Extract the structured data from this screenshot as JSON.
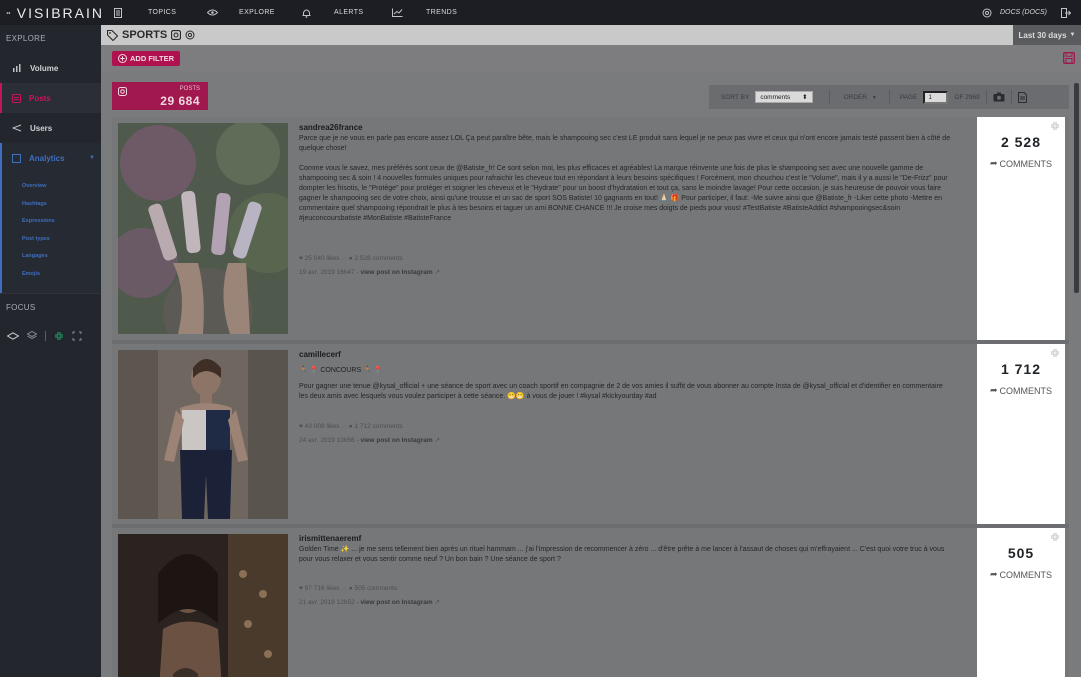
{
  "brand": {
    "name": "VISIBRAIN"
  },
  "nav": [
    {
      "label": "TOPICS",
      "icon": "document-icon"
    },
    {
      "label": "EXPLORE",
      "icon": "eye-icon"
    },
    {
      "label": "ALERTS",
      "icon": "bell-icon"
    },
    {
      "label": "TRENDS",
      "icon": "trend-chart-icon"
    }
  ],
  "topright": {
    "docs": "DOCS (DOCS)"
  },
  "sidebar": {
    "explore_head": "EXPLORE",
    "items": [
      {
        "label": "Volume"
      },
      {
        "label": "Posts"
      },
      {
        "label": "Users"
      },
      {
        "label": "Analytics"
      }
    ],
    "analytics_sub": [
      "Overview",
      "Hashtags",
      "Expressions",
      "Post types",
      "Langages",
      "Emojis"
    ],
    "focus_head": "FOCUS"
  },
  "titlebar": {
    "title": "SPORTS",
    "period": "Last 30 days"
  },
  "filters": {
    "add_label": "ADD FILTER"
  },
  "posts_box": {
    "label": "POSTS",
    "value": "29 684"
  },
  "sortbar": {
    "sort_label": "SORT BY",
    "sort_value": "comments",
    "order_label": "ORDER",
    "page_label": "PAGE",
    "page_value": "1",
    "of_label": "OF 2969"
  },
  "accent": "#c2185b",
  "posts": [
    {
      "user": "sandrea26france",
      "tags": "",
      "text1": "Parce que je ne vous en parle pas encore assez LOL Ça peut paraître bête, mais le shampooing sec c'est LE produit sans lequel je ne peux pas vivre et ceux qui n'ont encore jamais testé passent bien à côté de quelque chose!",
      "text2": "Comme vous le savez, mes préférés sont ceux de @Batiste_fr! Ce sont selon moi, les plus efficaces et agréables! La marque réinvente une fois de plus le shampooing sec avec une nouvelle gamme de shampooing sec & soin ! 4 nouvelles formules uniques pour rafraichir les cheveux tout en répondant à leurs besoins spécifiques ! Forcément, mon chouchou c'est le \"Volume\", mais il y a aussi le \"De-Frizz\" pour dompter les frisotis, le \"Protège\" pour protéger et soigner les cheveux et le \"Hydrate\" pour un boost d'hydratation et tout ça, sans le moindre lavage! Pour cette occasion, je suis heureuse de pouvoir vous faire gagner le shampooing sec de votre choix, ainsi qu'une trousse et un sac de sport SOS Batiste! 10 gagnants en tout! 🙏🏻 🎁 Pour participer, il faut: -Me suivre ainsi que @Batiste_fr -Liker cette photo -Mettre en commentaire quel shampooing répondrait le plus à tes besoins et taguer un ami BONNE CHANCE !!! Je croise mes doigts de pieds pour vous! #TestBatiste #BatisteAddict #shampooingsec&soin #jeuconcoursbatiste #MonBatiste #BatisteFrance",
      "likes": "25 040 likes",
      "comments": "2 528 comments",
      "date": "19 avr. 2019 16h47",
      "view": "view post on Instagram",
      "stat": "2 528",
      "stat_label": "COMMENTS"
    },
    {
      "user": "camillecerf",
      "tags": "🏃🏽 📍 CONCOURS 🏃🏽 📍",
      "text1": "Pour gagner une tenue @kysal_official + une séance de sport avec un coach sportif en compagnie de 2 de vos amies il suffit de vous abonner au compte Insta de @kysal_official et d'identifier en commentaire les deux amis avec lesquels vous voulez participer à cette séance. 😁😁 à vous de jouer ! #kysal #kickyourday #ad",
      "text2": "",
      "likes": "43 008 likes",
      "comments": "1 712 comments",
      "date": "24 avr. 2019 10h56",
      "view": "view post on Instagram",
      "stat": "1 712",
      "stat_label": "COMMENTS"
    },
    {
      "user": "irismittenaeremf",
      "tags": "",
      "text1": "Golden Time ✨ ... je me sens tellement bien après un rituel hammam ... j'ai l'impression de recommencer à zéro ... d'être prête à me lancer à l'assaut de choses qui m'effrayaient ... C'est quoi votre truc à vous pour vous relaxer et vous sentir comme neuf ? Un bon bain ? Une séance de sport ?",
      "text2": "",
      "likes": "97 716 likes",
      "comments": "505 comments",
      "date": "21 avr. 2019 12h52",
      "view": "view post on Instagram",
      "stat": "505",
      "stat_label": "COMMENTS"
    }
  ]
}
